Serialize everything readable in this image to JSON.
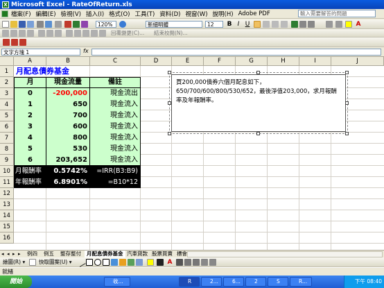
{
  "window": {
    "title": "Microsoft Excel - RateOfReturn.xls"
  },
  "menu": {
    "items": [
      "檔案(F)",
      "編輯(E)",
      "檢視(V)",
      "插入(I)",
      "格式(O)",
      "工具(T)",
      "資料(D)",
      "視窗(W)",
      "說明(H)",
      "Adobe PDF"
    ],
    "help_placeholder": "輸入需要解答的問題"
  },
  "format_toolbar": {
    "zoom": "120%",
    "font_name": "新細明體",
    "font_size": "12"
  },
  "review_toolbar": {
    "reply_changes": "回覆變更(C)...",
    "end_review": "結束校閱(N)..."
  },
  "formula_bar": {
    "name_box": "文字方塊 1",
    "fx": "fx",
    "formula": ""
  },
  "columns": [
    "A",
    "B",
    "C",
    "D",
    "E",
    "F",
    "G",
    "H",
    "I",
    "J"
  ],
  "rows": [
    "1",
    "2",
    "3",
    "4",
    "5",
    "6",
    "7",
    "8",
    "9",
    "10",
    "11",
    "12",
    "13",
    "14",
    "15",
    "16"
  ],
  "sheet": {
    "title": "月配息債券基金",
    "headers": {
      "month": "月",
      "cashflow": "現金流量",
      "note": "備註"
    },
    "data": [
      {
        "month": "0",
        "cashflow": "-200,000",
        "note": "現金流出"
      },
      {
        "month": "1",
        "cashflow": "650",
        "note": "現金流入"
      },
      {
        "month": "2",
        "cashflow": "700",
        "note": "現金流入"
      },
      {
        "month": "3",
        "cashflow": "600",
        "note": "現金流入"
      },
      {
        "month": "4",
        "cashflow": "800",
        "note": "現金流入"
      },
      {
        "month": "5",
        "cashflow": "530",
        "note": "現金流入"
      },
      {
        "month": "6",
        "cashflow": "203,652",
        "note": "現金流入"
      }
    ],
    "monthly": {
      "label": "月報酬率",
      "value": "0.5742%",
      "formula": "=IRR(B3:B9)"
    },
    "annual": {
      "label": "年報酬率",
      "value": "6.8901%",
      "formula": "=B10*12"
    }
  },
  "textbox": {
    "line1": "買200,000債券六個月配息如下，",
    "line2": "650/700/600/800/530/652，最後淨值203,000，求月報酬",
    "line3": "率及年報酬率。"
  },
  "tabs": [
    "例四",
    "例五",
    "整存整付",
    "月配息債券基金",
    "汽車貸款",
    "股票買賣",
    "標會"
  ],
  "active_tab": "月配息債券基金",
  "drawing_toolbar": {
    "draw": "繪圖(R) ▾",
    "autoshapes": "快取圖案(U) ▾"
  },
  "status": {
    "text": "就緒"
  },
  "taskbar": {
    "start": "開始",
    "tasks": [
      "收...",
      "R",
      "2...",
      "6...",
      "2",
      "S",
      "R..."
    ],
    "clock": "下午 08:40"
  },
  "colors": {
    "title_blue": "#0000ff",
    "green_fill": "#ccffcc",
    "negative_red": "#ff0000",
    "black_fill": "#000000"
  }
}
